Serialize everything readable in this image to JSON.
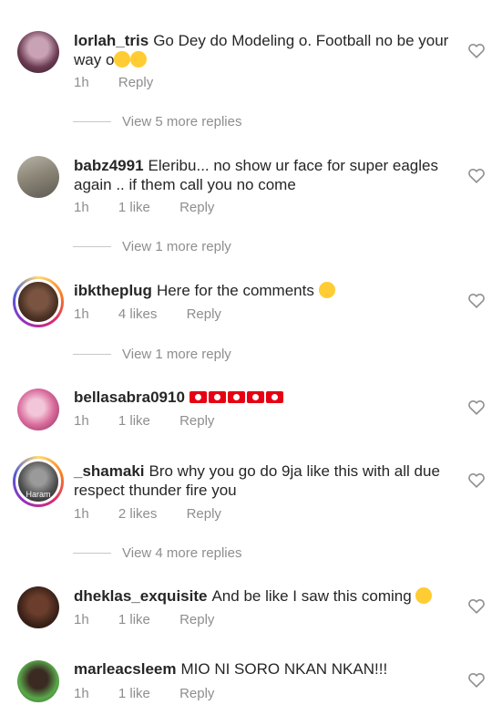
{
  "comments": [
    {
      "username": "lorlah_tris",
      "text": "Go Dey do Modeling o. Football no be your way o",
      "emoji": [
        "disappointed-face",
        "disappointed-face"
      ],
      "time": "1h",
      "likes": "",
      "reply_label": "Reply",
      "view_more": "View 5 more replies",
      "avatar_ring": false
    },
    {
      "username": "babz4991",
      "text": "Eleribu... no show ur face for super eagles again .. if them call you no come",
      "emoji": [],
      "time": "1h",
      "likes": "1 like",
      "reply_label": "Reply",
      "view_more": "View 1 more reply",
      "avatar_ring": false
    },
    {
      "username": "ibktheplug",
      "text": "Here for the comments",
      "emoji": [
        "grinning-sweat-face"
      ],
      "time": "1h",
      "likes": "4 likes",
      "reply_label": "Reply",
      "view_more": "View 1 more reply",
      "avatar_ring": true
    },
    {
      "username": "bellasabra0910",
      "text": "",
      "emoji": [
        "tunisia-flag",
        "tunisia-flag",
        "tunisia-flag",
        "tunisia-flag",
        "tunisia-flag"
      ],
      "time": "1h",
      "likes": "1 like",
      "reply_label": "Reply",
      "view_more": "",
      "avatar_ring": false
    },
    {
      "username": "_shamaki",
      "text": "Bro why you go do 9ja like this with all due respect thunder fire you",
      "emoji": [],
      "time": "1h",
      "likes": "2 likes",
      "reply_label": "Reply",
      "view_more": "View 4 more replies",
      "avatar_ring": true,
      "avatar_caption": "Haram"
    },
    {
      "username": "dheklas_exquisite",
      "text": "And be like I saw this coming",
      "emoji": [
        "smirking-face"
      ],
      "time": "1h",
      "likes": "1 like",
      "reply_label": "Reply",
      "view_more": "",
      "avatar_ring": false
    },
    {
      "username": "marleacsleem",
      "text": "MIO NI SORO NKAN NKAN!!!",
      "emoji": [],
      "time": "1h",
      "likes": "1 like",
      "reply_label": "Reply",
      "view_more": "",
      "avatar_ring": false
    }
  ],
  "icons": {
    "like": "heart-outline-icon"
  },
  "colors": {
    "text": "#262626",
    "secondary": "#8e8e8e",
    "divider": "#c7c7c7",
    "background": "#ffffff"
  }
}
